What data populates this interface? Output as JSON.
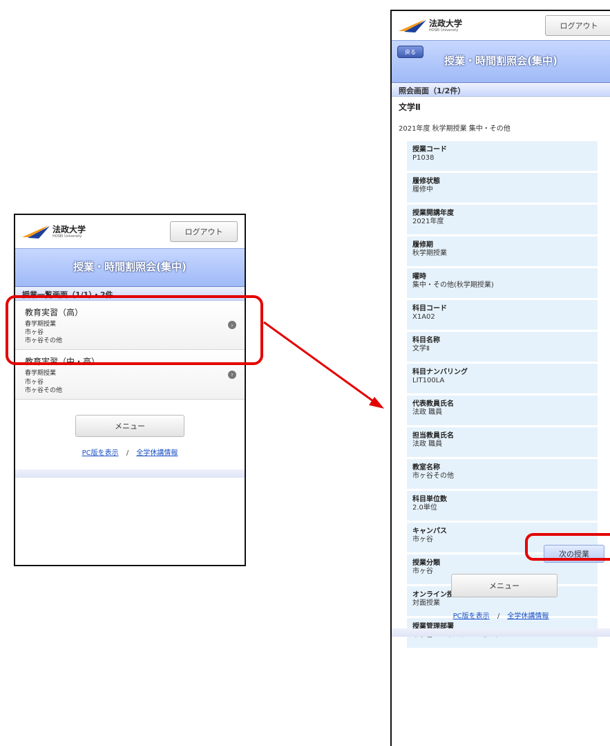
{
  "brand": {
    "name_jp": "法政大学",
    "name_en": "HOSEI University",
    "colors": {
      "accent_blue": "#9fbaf7",
      "highlight_red": "#e30000",
      "link": "#1a4fc4"
    }
  },
  "header": {
    "logout_label": "ログアウト"
  },
  "page_title": "授業・時間割照会(集中)",
  "left_screen": {
    "section_bar": "授業一覧画面（1/1）・2件",
    "items": [
      {
        "title": "教育実習（高）",
        "term": "春学期授業",
        "campus": "市ヶ谷",
        "room": "市ヶ谷その他"
      },
      {
        "title": "教育実習（中・高）",
        "term": "春学期授業",
        "campus": "市ヶ谷",
        "room": "市ヶ谷その他"
      }
    ]
  },
  "right_screen": {
    "back_label": "戻る",
    "section_bar": "照会画面（1/2件）",
    "course_name": "文学Ⅱ",
    "term_line": "2021年度 秋学期授業 集中・その他",
    "fields": [
      {
        "label": "授業コード",
        "value": "P1038"
      },
      {
        "label": "履修状態",
        "value": "履修中"
      },
      {
        "label": "授業開講年度",
        "value": "2021年度"
      },
      {
        "label": "履修期",
        "value": "秋学期授業"
      },
      {
        "label": "曜時",
        "value": "集中・その他(秋学期授業)"
      },
      {
        "label": "科目コード",
        "value": "X1A02"
      },
      {
        "label": "科目名称",
        "value": "文学Ⅱ"
      },
      {
        "label": "科目ナンバリング",
        "value": "LIT100LA"
      },
      {
        "label": "代表教員氏名",
        "value": "法政 職員"
      },
      {
        "label": "担当教員氏名",
        "value": "法政 職員"
      },
      {
        "label": "教室名称",
        "value": "市ヶ谷その他"
      },
      {
        "label": "科目単位数",
        "value": "2.0単位"
      },
      {
        "label": "キャンパス",
        "value": "市ヶ谷"
      },
      {
        "label": "授業分類",
        "value": "市ヶ谷"
      },
      {
        "label": "オンライン授業区分",
        "value": "対面授業"
      },
      {
        "label": "授業管理部署",
        "value": "市ヶ谷リベラルアーツセンター"
      }
    ],
    "next_label": "次の授業"
  },
  "footer": {
    "menu_label": "メニュー",
    "pc_link": "PC版を表示",
    "separator": "/",
    "holiday_link": "全学休講情報"
  }
}
